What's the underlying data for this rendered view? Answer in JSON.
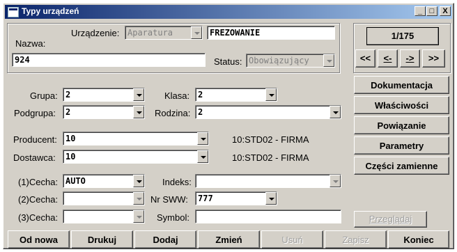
{
  "window": {
    "title": "Typy urządzeń",
    "controls": {
      "minimize": "_",
      "maximize": "□",
      "close": "X"
    }
  },
  "header": {
    "nazwa_label": "Nazwa:",
    "nazwa_value": "924",
    "urzadzenie_label": "Urządzenie:",
    "urzadzenie_value": "Aparatura",
    "frezowanie_value": "FREZOWANIE",
    "status_label": "Status:",
    "status_value": "Obowiązujący"
  },
  "pager": {
    "counter": "1/175",
    "first": "<<",
    "prev": "<-",
    "next": "->",
    "last": ">>"
  },
  "form": {
    "grupa_label": "Grupa:",
    "grupa_value": "2",
    "klasa_label": "Klasa:",
    "klasa_value": "2",
    "podgrupa_label": "Podgrupa:",
    "podgrupa_value": "2",
    "rodzina_label": "Rodzina:",
    "rodzina_value": "2",
    "producent_label": "Producent:",
    "producent_value": "10",
    "producent_desc": "10:STD02 - FIRMA",
    "dostawca_label": "Dostawca:",
    "dostawca_value": "10",
    "dostawca_desc": "10:STD02 - FIRMA",
    "cecha1_label": "(1)Cecha:",
    "cecha1_value": "AUTO",
    "indeks_label": "Indeks:",
    "indeks_value": "",
    "cecha2_label": "(2)Cecha:",
    "cecha2_value": "",
    "nrsww_label": "Nr SWW:",
    "nrsww_value": "777",
    "cecha3_label": "(3)Cecha:",
    "cecha3_value": "",
    "symbol_label": "Symbol:",
    "symbol_value": ""
  },
  "side_buttons": {
    "dokumentacja": "Dokumentacja",
    "wlasciwosci": "Właściwości",
    "powiazanie": "Powiązanie",
    "parametry": "Parametry",
    "czesci": "Części zamienne",
    "przegladaj": "Przeglądaj"
  },
  "toolbar": {
    "od_nowa": "Od nowa",
    "drukuj": "Drukuj",
    "dodaj": "Dodaj",
    "zmien": "Zmień",
    "usun": "Usuń",
    "zapisz": "Zapisz",
    "koniec": "Koniec"
  }
}
